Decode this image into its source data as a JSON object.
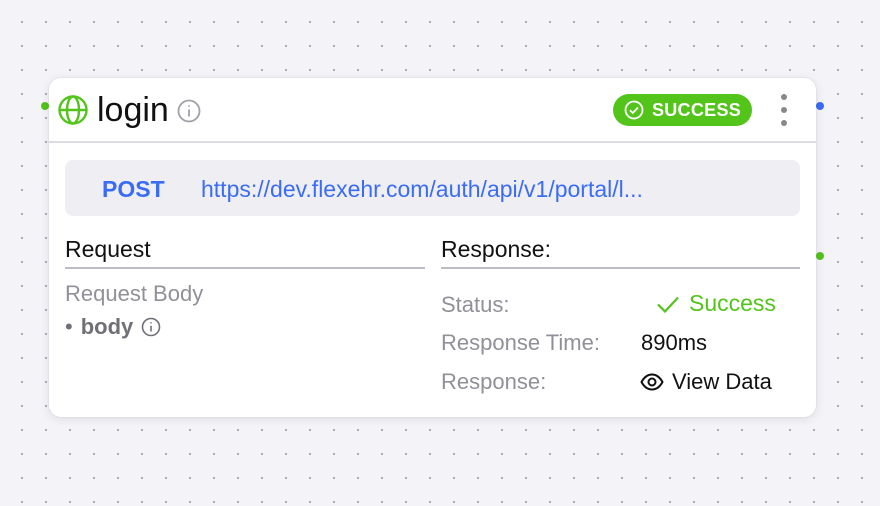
{
  "node": {
    "title": "login",
    "status_badge": "SUCCESS",
    "method": "POST",
    "url": "https://dev.flexehr.com/auth/api/v1/portal/l..."
  },
  "request": {
    "heading": "Request",
    "body_label": "Request Body",
    "bullet": "•",
    "items": [
      {
        "name": "body"
      }
    ]
  },
  "response": {
    "heading": "Response:",
    "status_label": "Status:",
    "status_value": "Success",
    "time_label": "Response Time:",
    "time_value": "890ms",
    "response_label": "Response:",
    "view_data_label": "View Data"
  },
  "colors": {
    "success": "#52c41a",
    "link": "#3b6cf6",
    "muted": "#909099"
  },
  "icons": {
    "node_type": "globe-icon",
    "title_info": "info-icon",
    "badge": "check-circle-icon",
    "menu": "more-vertical-icon",
    "status": "check-icon",
    "view": "eye-icon"
  }
}
